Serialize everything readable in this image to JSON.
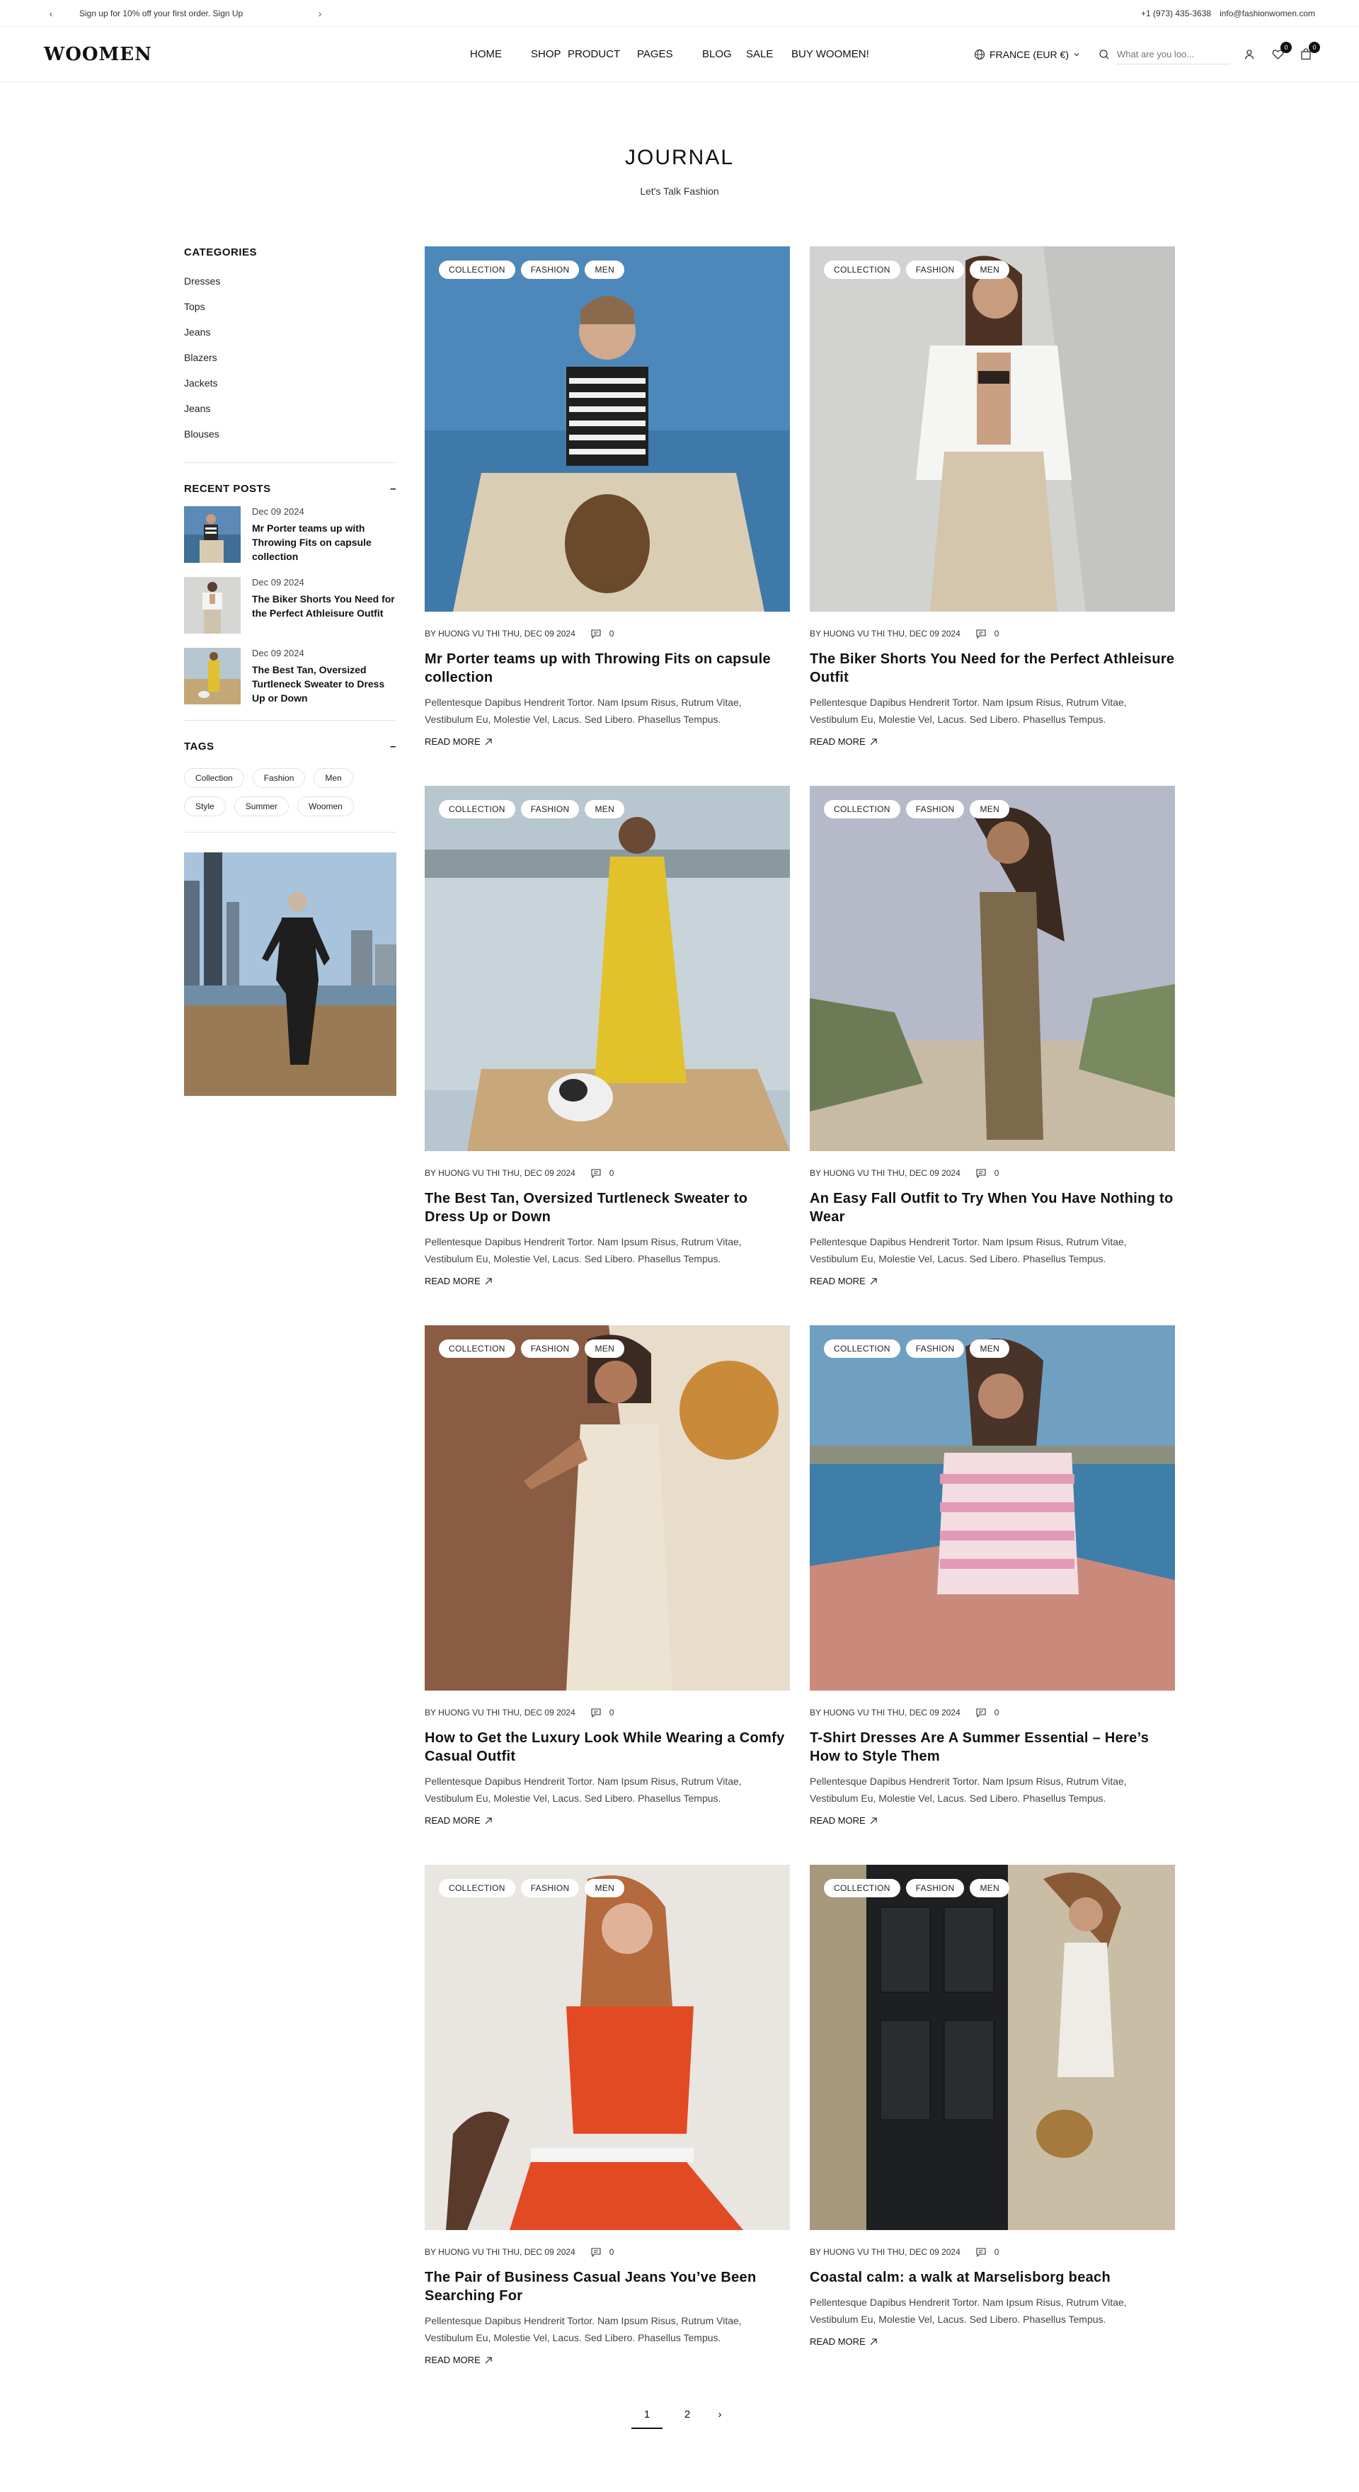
{
  "topbar": {
    "promo": "Sign up for 10% off your first order. Sign Up",
    "phone": "+1 (973) 435-3638",
    "email": "info@fashionwomen.com"
  },
  "header": {
    "logo": "WOOMEN",
    "nav": [
      "HOME",
      "SHOP",
      "PRODUCT",
      "PAGES",
      "BLOG",
      "SALE",
      "BUY WOOMEN!"
    ],
    "locale": "FRANCE (EUR €)",
    "search_placeholder": "What are you loo...",
    "wishlist_count": "0",
    "cart_count": "0"
  },
  "page": {
    "title": "JOURNAL",
    "subtitle": "Let's Talk Fashion"
  },
  "sidebar": {
    "categories_title": "CATEGORIES",
    "categories": [
      "Dresses",
      "Tops",
      "Jeans",
      "Blazers",
      "Jackets",
      "Jeans",
      "Blouses"
    ],
    "recent_title": "RECENT POSTS",
    "recent": [
      {
        "date": "Dec 09 2024",
        "title": "Mr Porter teams up with Throwing Fits on capsule collection"
      },
      {
        "date": "Dec 09 2024",
        "title": "The Biker Shorts You Need for the Perfect Athleisure Outfit"
      },
      {
        "date": "Dec 09 2024",
        "title": "The Best Tan, Oversized Turtleneck Sweater to Dress Up or Down"
      }
    ],
    "tags_title": "TAGS",
    "tags": [
      "Collection",
      "Fashion",
      "Men",
      "Style",
      "Summer",
      "Woomen"
    ],
    "collapse_symbol": "–"
  },
  "post_common": {
    "tags": [
      "COLLECTION",
      "FASHION",
      "MEN"
    ],
    "by": "BY",
    "author": "HUONG VU THI",
    "date": "THU, DEC 09 2024",
    "comments": "0",
    "excerpt": "Pellentesque Dapibus Hendrerit Tortor. Nam Ipsum Risus, Rutrum Vitae, Vestibulum Eu, Molestie Vel, Lacus. Sed Libero. Phasellus Tempus.",
    "read_more": "READ MORE"
  },
  "posts": [
    {
      "title": "Mr Porter teams up with Throwing Fits on capsule collection"
    },
    {
      "title": "The Biker Shorts You Need for the Perfect Athleisure Outfit"
    },
    {
      "title": "The Best Tan, Oversized Turtleneck Sweater to Dress Up or Down"
    },
    {
      "title": "An Easy Fall Outfit to Try When You Have Nothing to Wear"
    },
    {
      "title": "How to Get the Luxury Look While Wearing a Comfy Casual Outfit"
    },
    {
      "title": "T-Shirt Dresses Are A Summer Essential – Here’s How to Style Them"
    },
    {
      "title": "The Pair of Business Casual Jeans You’ve Been Searching For"
    },
    {
      "title": "Coastal calm: a walk at Marselisborg beach"
    }
  ],
  "pagination": {
    "pages": [
      "1",
      "2"
    ],
    "next": "›",
    "current": "1"
  },
  "colors": {
    "text": "#111111",
    "muted": "#444444",
    "border": "#e5e5e5",
    "badge": "#111111"
  },
  "icons": [
    "chevron-left-icon",
    "chevron-right-icon",
    "globe-icon",
    "chevron-down-icon",
    "search-icon",
    "user-icon",
    "heart-icon",
    "bag-icon",
    "comment-icon",
    "arrow-up-right-icon"
  ]
}
